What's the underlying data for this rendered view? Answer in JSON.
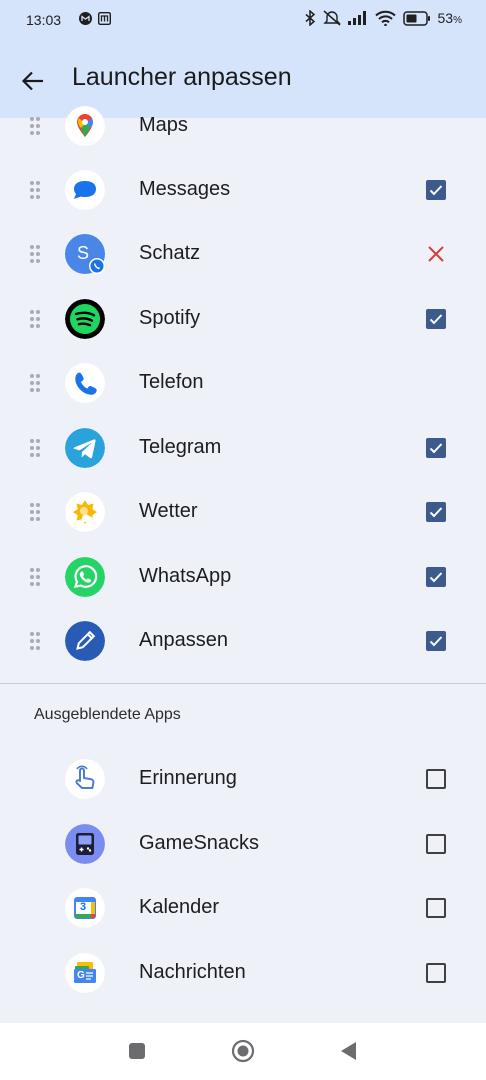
{
  "status_bar": {
    "time": "13:03",
    "battery_percent": "53",
    "battery_unit": "%",
    "icons": [
      "gmail-icon",
      "m-app-icon",
      "bluetooth-icon",
      "mute-icon",
      "signal-icon",
      "wifi-icon",
      "battery-icon"
    ]
  },
  "appbar": {
    "title": "Launcher anpassen",
    "back_icon": "arrow-left-icon"
  },
  "visible_apps": [
    {
      "label": "Maps",
      "icon": "maps-icon",
      "state": "none"
    },
    {
      "label": "Messages",
      "icon": "messages-icon",
      "state": "checked"
    },
    {
      "label": "Schatz",
      "icon": "contact-avatar-icon",
      "avatar_letter": "S",
      "state": "remove"
    },
    {
      "label": "Spotify",
      "icon": "spotify-icon",
      "state": "checked"
    },
    {
      "label": "Telefon",
      "icon": "phone-icon",
      "state": "none"
    },
    {
      "label": "Telegram",
      "icon": "telegram-icon",
      "state": "checked"
    },
    {
      "label": "Wetter",
      "icon": "weather-icon",
      "state": "checked"
    },
    {
      "label": "WhatsApp",
      "icon": "whatsapp-icon",
      "state": "checked"
    },
    {
      "label": "Anpassen",
      "icon": "pencil-icon",
      "state": "checked"
    }
  ],
  "hidden_section": {
    "title": "Ausgeblendete Apps",
    "apps": [
      {
        "label": "Erinnerung",
        "icon": "reminder-hand-icon",
        "state": "unchecked"
      },
      {
        "label": "GameSnacks",
        "icon": "gamesnacks-icon",
        "state": "unchecked"
      },
      {
        "label": "Kalender",
        "icon": "calendar-icon",
        "calendar_day": "3",
        "state": "unchecked"
      },
      {
        "label": "Nachrichten",
        "icon": "news-icon",
        "news_letters": "G",
        "state": "unchecked"
      }
    ]
  },
  "nav_bar": {
    "buttons": [
      "recents-square-icon",
      "home-circle-icon",
      "back-triangle-icon"
    ]
  },
  "colors": {
    "header_bg": "#d5e3fb",
    "page_bg": "#eff1f8",
    "checkbox_checked": "#3d5a8c",
    "remove_x": "#d93a3a"
  }
}
